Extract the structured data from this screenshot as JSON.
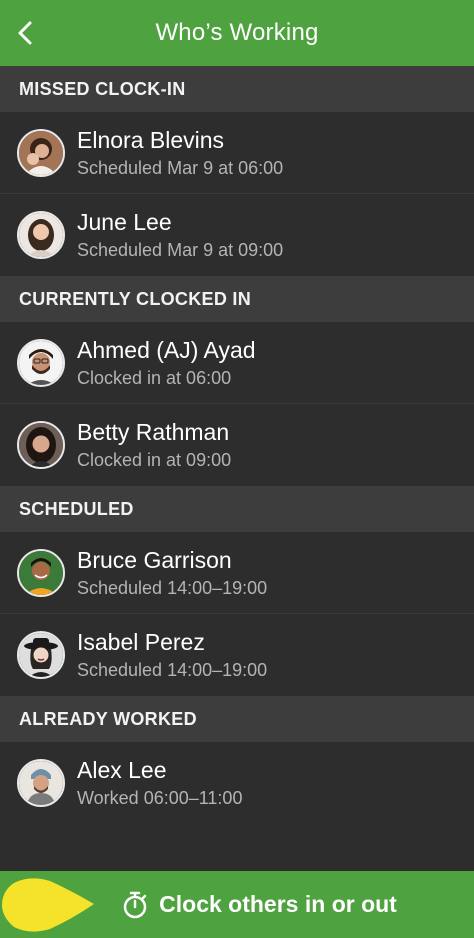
{
  "header": {
    "title": "Who’s Working",
    "back_icon": "chevron-left-icon"
  },
  "sections": [
    {
      "title": "MISSED CLOCK-IN",
      "people": [
        {
          "name": "Elnora Blevins",
          "detail": "Scheduled Mar 9 at 06:00"
        },
        {
          "name": "June Lee",
          "detail": "Scheduled Mar 9 at 09:00"
        }
      ]
    },
    {
      "title": "CURRENTLY CLOCKED IN",
      "people": [
        {
          "name": "Ahmed (AJ) Ayad",
          "detail": "Clocked in at 06:00"
        },
        {
          "name": "Betty Rathman",
          "detail": "Clocked in at 09:00"
        }
      ]
    },
    {
      "title": "SCHEDULED",
      "people": [
        {
          "name": "Bruce Garrison",
          "detail": "Scheduled 14:00–19:00"
        },
        {
          "name": "Isabel Perez",
          "detail": "Scheduled 14:00–19:00"
        }
      ]
    },
    {
      "title": "ALREADY WORKED",
      "people": [
        {
          "name": "Alex Lee",
          "detail": "Worked 06:00–11:00"
        }
      ]
    }
  ],
  "bottom_action": {
    "label": "Clock others in or out",
    "icon": "stopwatch-icon"
  },
  "colors": {
    "brand_green": "#4ea240",
    "section_bg": "#3d3d3d",
    "row_bg": "#2d2d2d",
    "pointer_yellow": "#f5e32b"
  }
}
